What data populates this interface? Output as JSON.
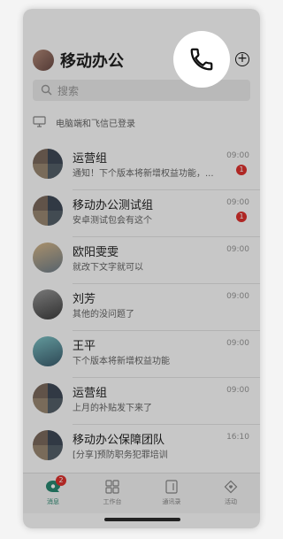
{
  "header": {
    "title": "移动办公",
    "add_icon": "plus-circle-icon",
    "call_icon": "phone-icon"
  },
  "search": {
    "placeholder": "搜索"
  },
  "notice": {
    "text": "电脑端和飞信已登录"
  },
  "chats": [
    {
      "name": "运营组",
      "message": "通知！下个版本将新增权益功能，...",
      "time": "09:00",
      "badge": "1",
      "avatar": "group"
    },
    {
      "name": "移动办公测试组",
      "message": "安卓测试包会有这个",
      "time": "09:00",
      "badge": "1",
      "avatar": "group"
    },
    {
      "name": "欧阳雯雯",
      "message": "就改下文字就可以",
      "time": "09:00",
      "badge": "",
      "avatar": "single"
    },
    {
      "name": "刘芳",
      "message": "其他的没问题了",
      "time": "09:00",
      "badge": "",
      "avatar": "single"
    },
    {
      "name": "王平",
      "message": "下个版本将新增权益功能",
      "time": "09:00",
      "badge": "",
      "avatar": "single"
    },
    {
      "name": "运营组",
      "message": "上月的补贴发下来了",
      "time": "09:00",
      "badge": "",
      "avatar": "group"
    },
    {
      "name": "移动办公保障团队",
      "message": "[分享]预防职务犯罪培训",
      "time": "16:10",
      "badge": "",
      "avatar": "group"
    }
  ],
  "tabs": [
    {
      "label": "消息",
      "icon": "message-icon",
      "badge": "2",
      "active": true
    },
    {
      "label": "工作台",
      "icon": "grid-icon",
      "badge": "",
      "active": false
    },
    {
      "label": "通讯录",
      "icon": "contacts-icon",
      "badge": "",
      "active": false
    },
    {
      "label": "活动",
      "icon": "heart-diamond-icon",
      "badge": "",
      "active": false
    }
  ],
  "colors": {
    "accent": "#2a8a72",
    "badge": "#e0322f"
  }
}
